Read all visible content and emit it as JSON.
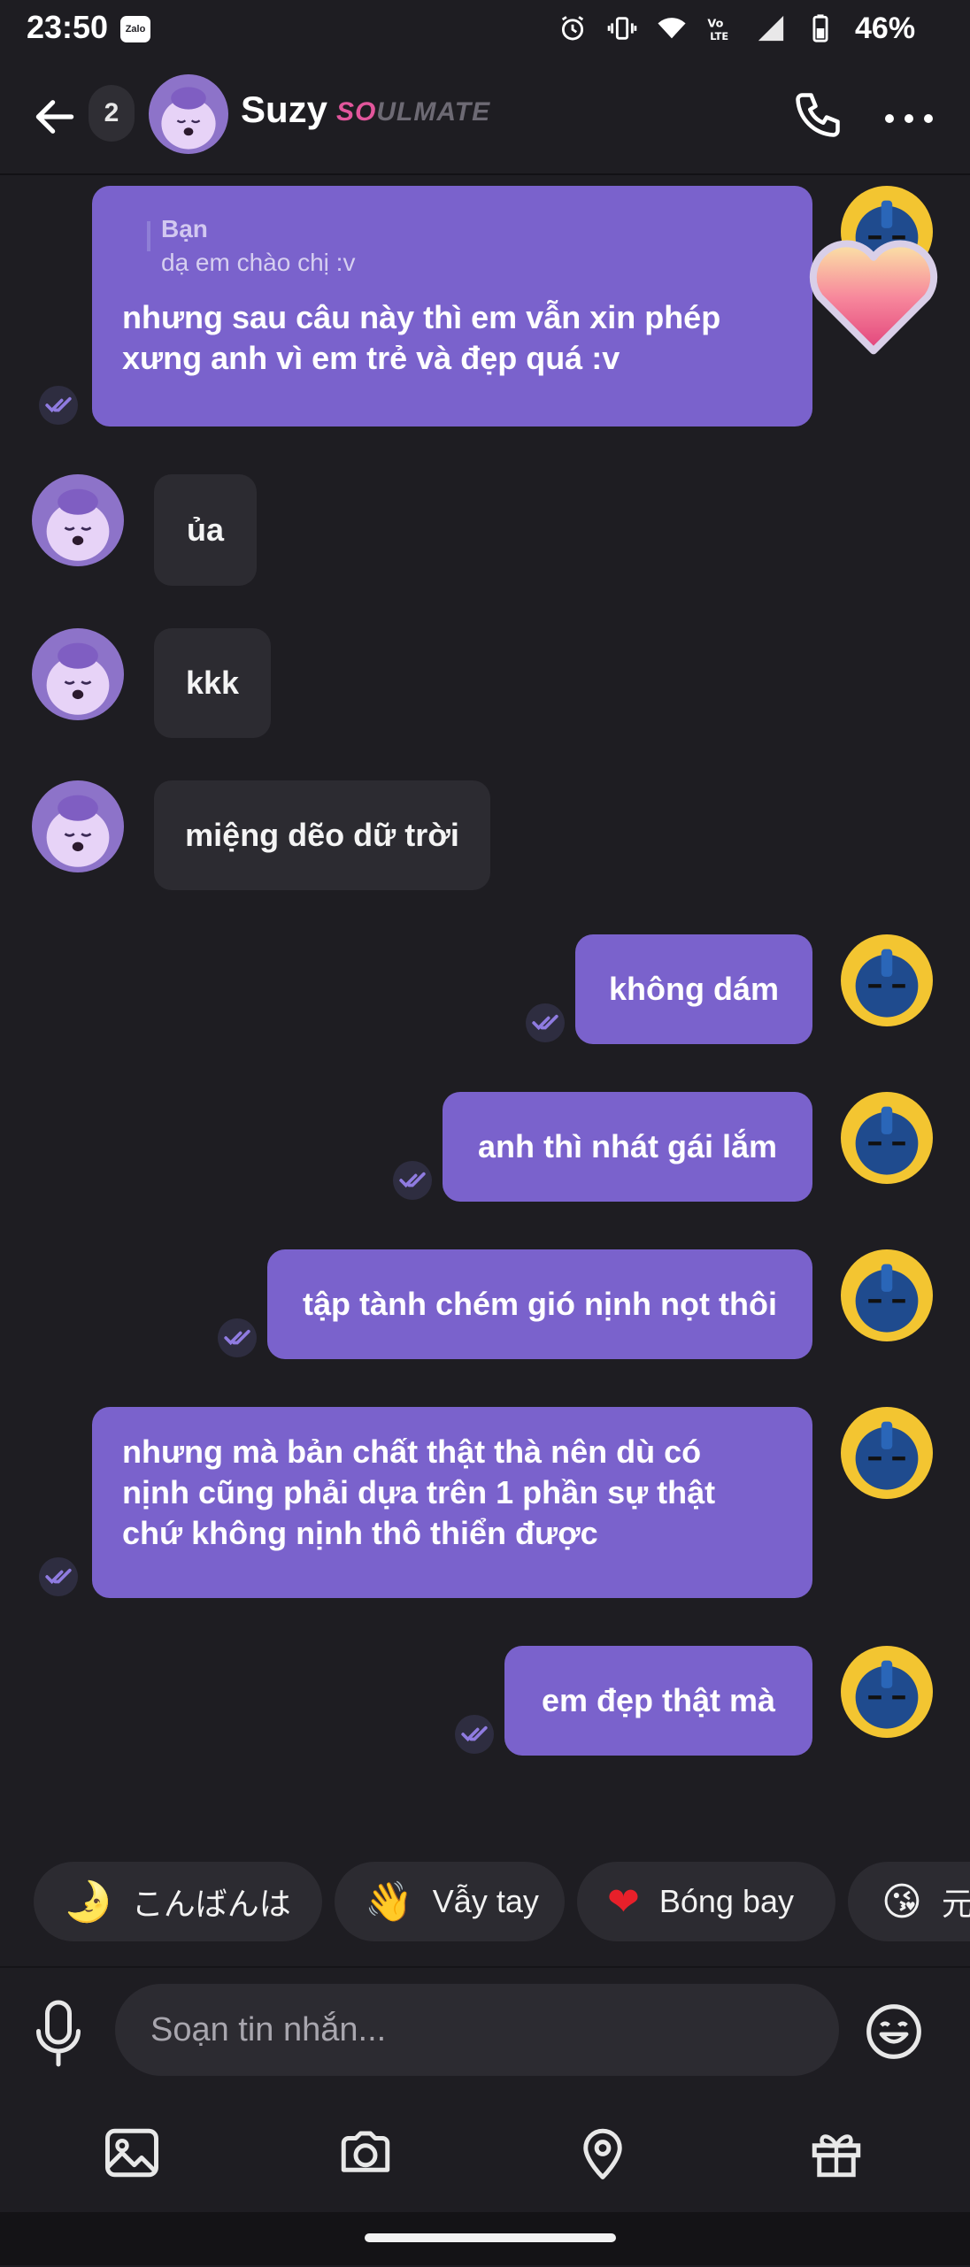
{
  "status_bar": {
    "time": "23:50",
    "zalo_label": "Zalo",
    "battery": "46%"
  },
  "header": {
    "unread_count": "2",
    "contact_name": "Suzy",
    "tag_part1": "SO",
    "tag_part2": "ULMATE"
  },
  "messages": [
    {
      "from": "me",
      "quote_author": "Bạn",
      "quote_text": "dạ em chào chị :v",
      "text_line1": "nhưng sau câu này thì em vẫn xin phép",
      "text_line2": "xưng anh vì em trẻ và đẹp quá :v"
    },
    {
      "from": "them",
      "text": "ủa"
    },
    {
      "from": "them",
      "text": "kkk"
    },
    {
      "from": "them",
      "text": "miệng dẽo dữ trời"
    },
    {
      "from": "me",
      "text": "không dám"
    },
    {
      "from": "me",
      "text": "anh thì nhát gái lắm"
    },
    {
      "from": "me",
      "text": "tập tành chém gió nịnh nọt thôi"
    },
    {
      "from": "me",
      "text_line1": "nhưng mà bản chất thật thà nên dù có",
      "text_line2": "nịnh cũng phải dựa trên 1 phần sự thật",
      "text_line3": "chứ không nịnh thô thiển được"
    },
    {
      "from": "me",
      "text": "em đẹp thật mà"
    }
  ],
  "quick_replies": [
    {
      "emoji": "🌛",
      "label": "こんばんは"
    },
    {
      "emoji": "👋",
      "label": "Vẫy tay"
    },
    {
      "emoji": "❤",
      "label": "Bóng bay"
    },
    {
      "emoji": "😘",
      "label": "元"
    }
  ],
  "composer": {
    "placeholder": "Soạn tin nhắn..."
  },
  "colors": {
    "background": "#1e1d22",
    "my_bubble": "#7a62cc",
    "their_bubble": "#2c2b31",
    "tag_pink": "#e2569c"
  }
}
